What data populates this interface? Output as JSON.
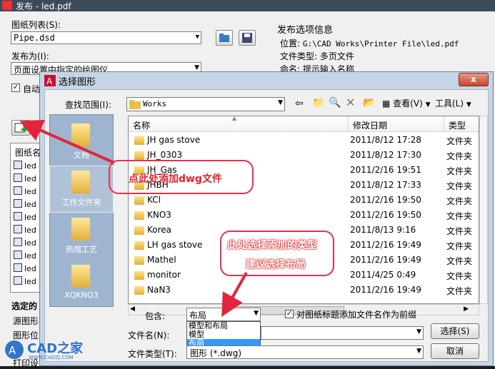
{
  "publish_window": {
    "title": "发布 - led.pdf",
    "sheet_list_label": "图纸列表(S):",
    "sheet_list_value": "Pipe.dsd",
    "publish_to_label": "发布为(I):",
    "publish_to_value": "页面设置中指定的绘图仪",
    "auto_checkbox_label": "自动",
    "sheet_name_header": "图纸名",
    "sheet_rows": [
      "led",
      "led",
      "led",
      "led",
      "led",
      "led",
      "led",
      "led",
      "led",
      "led"
    ],
    "selected_section_label": "选定的",
    "source_drawing_label": "源图形",
    "drawing_position_label": "图形位",
    "print_label": "打印设",
    "option_info_title": "发布选项信息",
    "location_label": "位置:",
    "location_value": "G:\\CAD Works\\Printer File\\led.pdf",
    "file_type_label": "文件类型:",
    "file_type_value": "多页文件",
    "naming_label": "命名:",
    "naming_value": "提示输入名称"
  },
  "dialog": {
    "title": "选择图形",
    "close_label": "x",
    "look_in_label": "查找范围(I):",
    "look_in_value": "Works",
    "view_label": "查看(V)",
    "tools_label": "工具(L)",
    "places": [
      {
        "label": "文档"
      },
      {
        "label": "工作文件夹"
      },
      {
        "label": "热熔工艺"
      },
      {
        "label": "XQKNO3"
      }
    ],
    "columns": {
      "name": "名称",
      "date": "修改日期",
      "type": "类型"
    },
    "files": [
      {
        "name": "JH gas stove",
        "date": "2011/8/12 17:28",
        "type": "文件夹"
      },
      {
        "name": "JH_0303",
        "date": "2011/8/12 17:30",
        "type": "文件夹"
      },
      {
        "name": "JH_Gas",
        "date": "2011/2/16 19:51",
        "type": "文件夹"
      },
      {
        "name": "JHBH",
        "date": "2011/8/12 17:33",
        "type": "文件夹"
      },
      {
        "name": "KCl",
        "date": "2011/2/16 19:50",
        "type": "文件夹"
      },
      {
        "name": "KNO3",
        "date": "2011/2/16 19:50",
        "type": "文件夹"
      },
      {
        "name": "Korea",
        "date": "2011/8/13 9:16",
        "type": "文件夹"
      },
      {
        "name": "LH gas stove",
        "date": "2011/2/16 19:49",
        "type": "文件夹"
      },
      {
        "name": "Mathel",
        "date": "2011/2/16 19:49",
        "type": "文件夹"
      },
      {
        "name": "monitor",
        "date": "2011/4/25 0:49",
        "type": "文件夹"
      },
      {
        "name": "NaN3",
        "date": "2011/2/16 19:49",
        "type": "文件夹"
      }
    ],
    "include_label": "包含:",
    "include_value": "布局",
    "include_options": [
      "模型和布局",
      "模型",
      "布局"
    ],
    "prefix_checkbox_label": "对图纸标题添加文件名作为前缀",
    "filename_label": "文件名(N):",
    "filename_value": "",
    "filetype_label": "文件类型(T):",
    "filetype_value": "图形 (*.dwg)",
    "select_button": "选择(S)",
    "cancel_button": "取消"
  },
  "annotations": {
    "add_dwg": "点此处添加dwg文件",
    "select_type_line1": "此处选择添加的类型",
    "select_type_line2": "建议选择布局"
  },
  "watermark": {
    "text": "CAD之家",
    "url": "WWW.CADZJ.COM"
  },
  "colors": {
    "annotation_red": "#e02030",
    "selection_blue": "#3399ff"
  }
}
